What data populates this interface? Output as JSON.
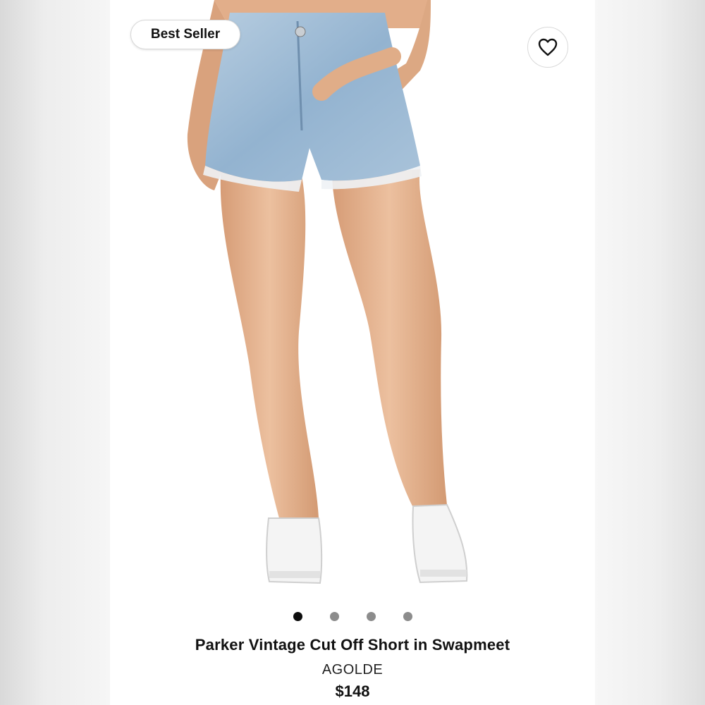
{
  "badge": {
    "label": "Best Seller"
  },
  "favorite": {
    "icon": "heart-icon"
  },
  "carousel": {
    "count": 4,
    "active_index": 0
  },
  "product": {
    "title": "Parker Vintage Cut Off Short in Swapmeet",
    "brand": "AGOLDE",
    "price": "$148"
  },
  "colors": {
    "denim": "#9ab8d4",
    "skin": "#e3b08e",
    "sneaker": "#f4f4f4"
  }
}
